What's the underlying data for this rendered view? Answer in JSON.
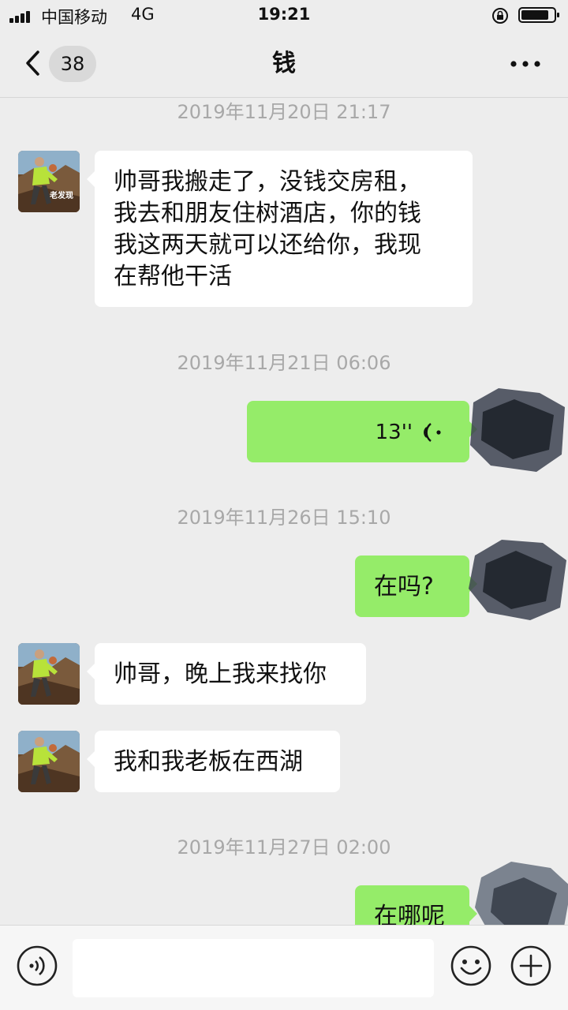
{
  "status_bar": {
    "carrier": "中国移动",
    "network": "4G",
    "time": "19:21"
  },
  "nav": {
    "unread_count": "38",
    "title": "钱"
  },
  "messages": [
    {
      "type": "timestamp",
      "text": "2019年11月20日 21:17"
    },
    {
      "type": "text",
      "direction": "in",
      "lines": [
        "帅哥我搬走了，没钱交房租，",
        "我去和朋友住树酒店，你的钱",
        "我这两天就可以还给你，我现",
        "在帮他干活"
      ]
    },
    {
      "type": "timestamp",
      "text": "2019年11月21日 06:06"
    },
    {
      "type": "voice",
      "direction": "out",
      "duration": "13''"
    },
    {
      "type": "timestamp",
      "text": "2019年11月26日 15:10"
    },
    {
      "type": "text",
      "direction": "out",
      "text": "在吗?"
    },
    {
      "type": "text",
      "direction": "in",
      "text": "帅哥，晚上我来找你"
    },
    {
      "type": "text",
      "direction": "in",
      "text": "我和我老板在西湖"
    },
    {
      "type": "timestamp",
      "text": "2019年11月27日 02:00"
    },
    {
      "type": "text",
      "direction": "out",
      "text": "在哪呢"
    }
  ],
  "avatar_caption": "老发现",
  "icons": {
    "back": "chevron-left-icon",
    "more": "more-dots-icon",
    "voice_msg": "voice-wave-icon",
    "voice_input": "voice-input-icon",
    "emoji": "emoji-icon",
    "plus": "plus-icon"
  },
  "colors": {
    "background": "#ededed",
    "outgoing_bubble": "#95ec69",
    "incoming_bubble": "#ffffff",
    "timestamp_text": "#a8a8a8"
  }
}
